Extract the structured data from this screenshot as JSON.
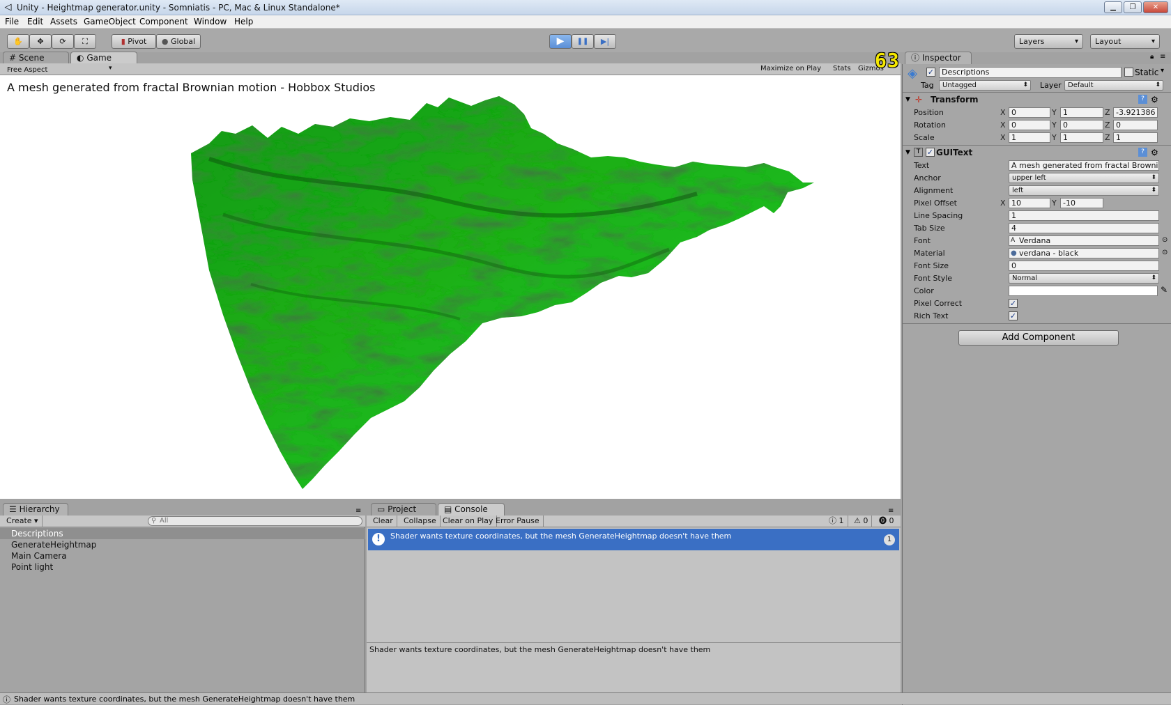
{
  "window": {
    "title": "Unity - Heightmap generator.unity - Somniatis - PC, Mac & Linux Standalone*",
    "buttons": [
      "▁",
      "❐",
      "✕"
    ]
  },
  "menu": [
    "File",
    "Edit",
    "Assets",
    "GameObject",
    "Component",
    "Window",
    "Help"
  ],
  "toolbar": {
    "pivot_label": "Pivot",
    "global_label": "Global",
    "play_icon": "▶",
    "pause_icon": "❚❚",
    "step_icon": "▶|",
    "layers_label": "Layers",
    "layout_label": "Layout"
  },
  "view_tabs": {
    "scene_label": "Scene",
    "game_label": "Game"
  },
  "game": {
    "aspect_label": "Free Aspect",
    "maximize_label": "Maximize on Play",
    "stats_label": "Stats",
    "gizmos_label": "Gizmos",
    "overlay_text": "A mesh generated from fractal Brownian motion - Hobbox Studios",
    "fps": "63"
  },
  "inspector": {
    "tab_label": "Inspector",
    "object_name": "Descriptions",
    "static_label": "Static",
    "tag_label": "Tag",
    "tag_value": "Untagged",
    "layer_label": "Layer",
    "layer_value": "Default",
    "transform": {
      "title": "Transform",
      "position_label": "Position",
      "rotation_label": "Rotation",
      "scale_label": "Scale",
      "position": {
        "x": "0",
        "y": "1",
        "z": "-3.921386"
      },
      "rotation": {
        "x": "0",
        "y": "0",
        "z": "0"
      },
      "scale": {
        "x": "1",
        "y": "1",
        "z": "1"
      }
    },
    "guitext": {
      "title": "GUIText",
      "text_label": "Text",
      "text_value": "A mesh generated from fractal Brownian motion - Hobbox Studios",
      "anchor_label": "Anchor",
      "anchor_value": "upper left",
      "alignment_label": "Alignment",
      "alignment_value": "left",
      "pixel_offset_label": "Pixel Offset",
      "pixel_offset_x": "10",
      "pixel_offset_y": "-10",
      "line_spacing_label": "Line Spacing",
      "line_spacing_value": "1",
      "tab_size_label": "Tab Size",
      "tab_size_value": "4",
      "font_label": "Font",
      "font_value": "Verdana",
      "material_label": "Material",
      "material_value": "verdana - black",
      "font_size_label": "Font Size",
      "font_size_value": "0",
      "font_style_label": "Font Style",
      "font_style_value": "Normal",
      "color_label": "Color",
      "pixel_correct_label": "Pixel Correct",
      "rich_text_label": "Rich Text"
    },
    "add_component_label": "Add Component"
  },
  "hierarchy": {
    "tab_label": "Hierarchy",
    "create_label": "Create",
    "search_placeholder": "All",
    "items": [
      "Descriptions",
      "GenerateHeightmap",
      "Main Camera",
      "Point light"
    ]
  },
  "console": {
    "project_tab": "Project",
    "console_tab": "Console",
    "clear_label": "Clear",
    "collapse_label": "Collapse",
    "clear_on_play_label": "Clear on Play",
    "error_pause_label": "Error Pause",
    "info_count": "1",
    "warn_count": "0",
    "error_count": "0",
    "entries": [
      {
        "message": "Shader wants texture coordinates, but the mesh GenerateHeightmap doesn't have them",
        "count": "1"
      }
    ],
    "detail": "Shader wants texture coordinates, but the mesh GenerateHeightmap doesn't have them"
  },
  "statusbar": {
    "message": "Shader wants texture coordinates, but the mesh GenerateHeightmap doesn't have them"
  },
  "colors": {
    "terrain_light": "#22c51e",
    "terrain_dark": "#0b4a0a",
    "selection": "#3a6fc4",
    "fps_yellow": "#f5e800"
  }
}
